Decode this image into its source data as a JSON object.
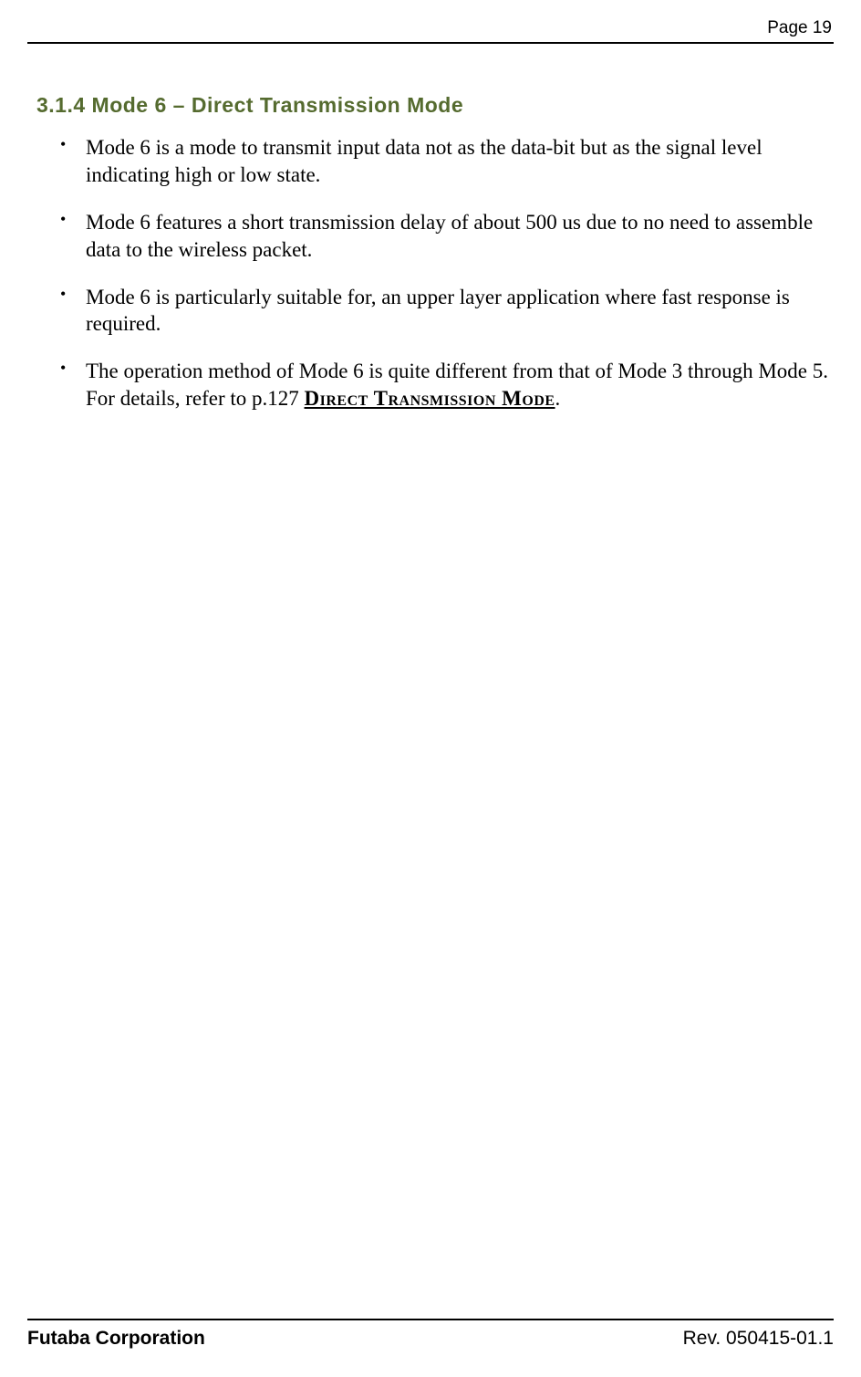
{
  "header": {
    "page_label": "Page  19"
  },
  "section": {
    "heading": "3.1.4  Mode 6 – Direct Transmission Mode",
    "bullets": [
      "Mode 6 is a mode to transmit input data not as the data-bit but as the signal level indicating high or low state.",
      "Mode 6 features a short transmission delay of about 500 us due to no need to assemble data to the wireless packet.",
      "Mode 6 is particularly suitable for, an upper layer application where fast response is required."
    ],
    "bullet4_prefix": "The operation method of Mode 6 is quite different from that of Mode 3 through Mode 5. For details, refer to p.127 ",
    "bullet4_link": "Direct Transmission Mode",
    "bullet4_suffix": "."
  },
  "footer": {
    "left": "Futaba Corporation",
    "right": "Rev. 050415-01.1"
  }
}
